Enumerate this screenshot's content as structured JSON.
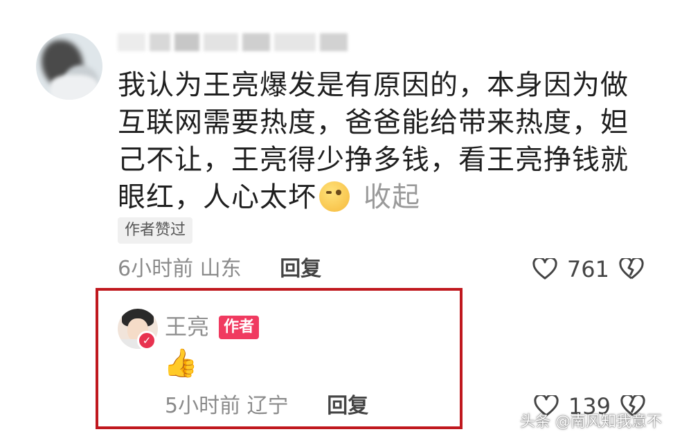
{
  "comment": {
    "avatar_icon": "blurred-user-avatar",
    "body_lines": [
      "我认为王亮爆发是有原因的，本身因为做",
      "互联网需要热度，爸爸能给带来热度，妲",
      "己不让，王亮得少挣多钱，看王亮挣钱就",
      "眼红，人心太坏"
    ],
    "emoji": "thinking-face-emoji",
    "collapse_label": "收起",
    "author_liked_badge": "作者赞过",
    "time": "6小时前",
    "location": "山东",
    "reply_label": "回复",
    "like_count": "761"
  },
  "author_reply": {
    "name": "王亮",
    "author_tag": "作者",
    "content_emoji": "👍",
    "time": "5小时前",
    "location": "辽宁",
    "reply_label": "回复",
    "like_count": "139"
  },
  "highlight_color": "#c0181e",
  "author_tag_color": "#f03a60",
  "watermark": "头条 @南风知我意不"
}
